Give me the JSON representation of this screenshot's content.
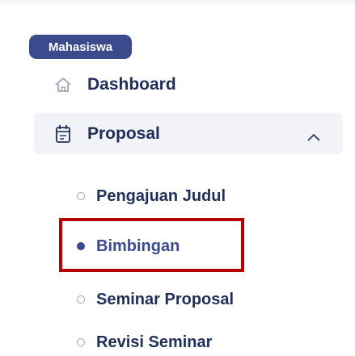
{
  "role_badge": "Mahasiswa",
  "nav": {
    "dashboard": {
      "label": "Dashboard",
      "icon": "home-icon"
    },
    "proposal": {
      "label": "Proposal",
      "icon": "calendar-icon",
      "expanded": true
    }
  },
  "submenu": [
    {
      "label": "Pengajuan Judul",
      "active": false
    },
    {
      "label": "Bimbingan",
      "active": true
    },
    {
      "label": "Seminar Proposal",
      "active": false
    },
    {
      "label": "Revisi Seminar",
      "active": false
    }
  ],
  "colors": {
    "brand": "#3b4a8c",
    "text": "#1f2f57",
    "highlight_border": "#b50000",
    "active_bg": "#f1f3f8"
  }
}
